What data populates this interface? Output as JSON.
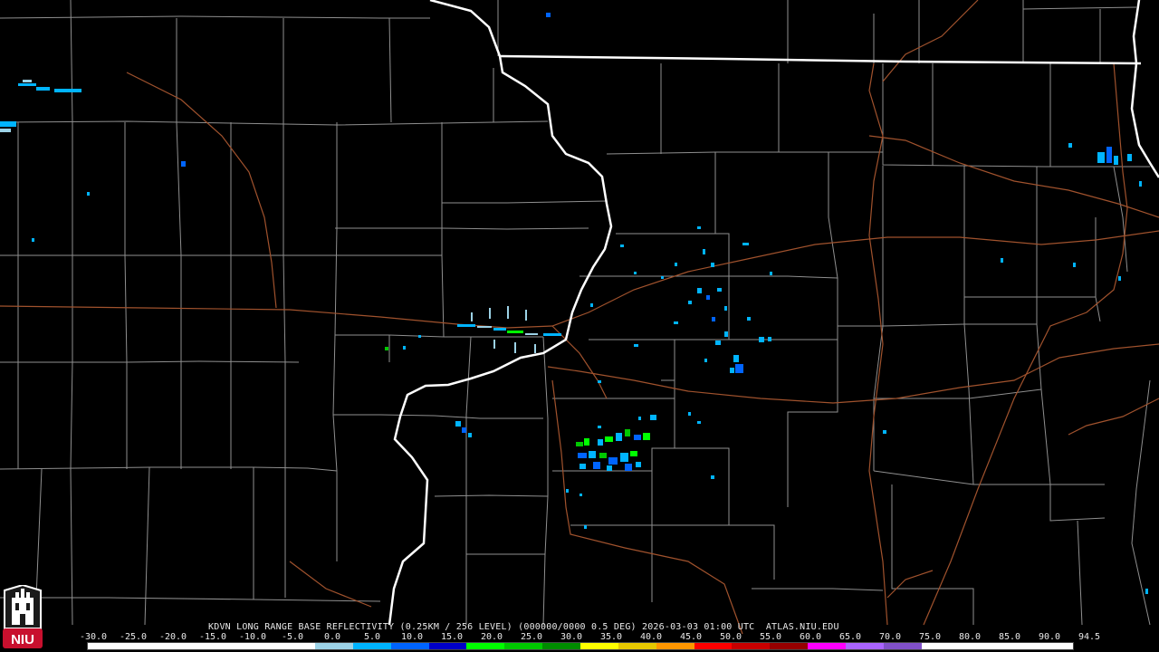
{
  "product": {
    "caption": "KDVN LONG RANGE BASE REFLECTIVITY (0.25KM / 256 LEVEL) (000000/0000 0.5 DEG) 2026-03-03 01:00 UTC  ATLAS.NIU.EDU",
    "radar_site": "KDVN",
    "elevation_deg": 0.5,
    "datetime": "2026-03-03 01:00 UTC",
    "source": "ATLAS.NIU.EDU"
  },
  "logo": {
    "text": "NIU",
    "icon": "niu-tower-logo-icon",
    "color": "#c8102e"
  },
  "colorscale": {
    "labels": [
      "-30.0",
      "-25.0",
      "-20.0",
      "-15.0",
      "-10.0",
      "-5.0",
      "0.0",
      "5.0",
      "10.0",
      "15.0",
      "20.0",
      "25.0",
      "30.0",
      "35.0",
      "40.0",
      "45.0",
      "50.0",
      "55.0",
      "60.0",
      "65.0",
      "70.0",
      "75.0",
      "80.0",
      "85.0",
      "90.0",
      "94.5"
    ],
    "colors": [
      "#ffffff",
      "#ffffff",
      "#ffffff",
      "#ffffff",
      "#ffffff",
      "#ffffff",
      "#9cd2e6",
      "#00b4ff",
      "#0064ff",
      "#0000c8",
      "#00ff00",
      "#00c800",
      "#008c00",
      "#ffff00",
      "#e6c800",
      "#ff9600",
      "#ff0000",
      "#c80000",
      "#960000",
      "#ff00ff",
      "#aa64ff",
      "#8050c8",
      "#ffffff",
      "#ffffff",
      "#ffffff",
      "#ffffff"
    ]
  },
  "map": {
    "colors": {
      "background": "#000000",
      "county": "#8f8f8f",
      "state": "#ffffff",
      "highway": "#a0522d"
    },
    "echo_clusters": [
      {
        "name": "echoes-southeast-iowa",
        "max_dbz": 22
      },
      {
        "name": "echoes-west-central-illinois",
        "max_dbz": 12
      },
      {
        "name": "echoes-ground-clutter-kdvn",
        "max_dbz": 10
      },
      {
        "name": "echoes-northwest-iowa",
        "max_dbz": 8
      },
      {
        "name": "echoes-chicago-area",
        "max_dbz": 10
      }
    ]
  }
}
